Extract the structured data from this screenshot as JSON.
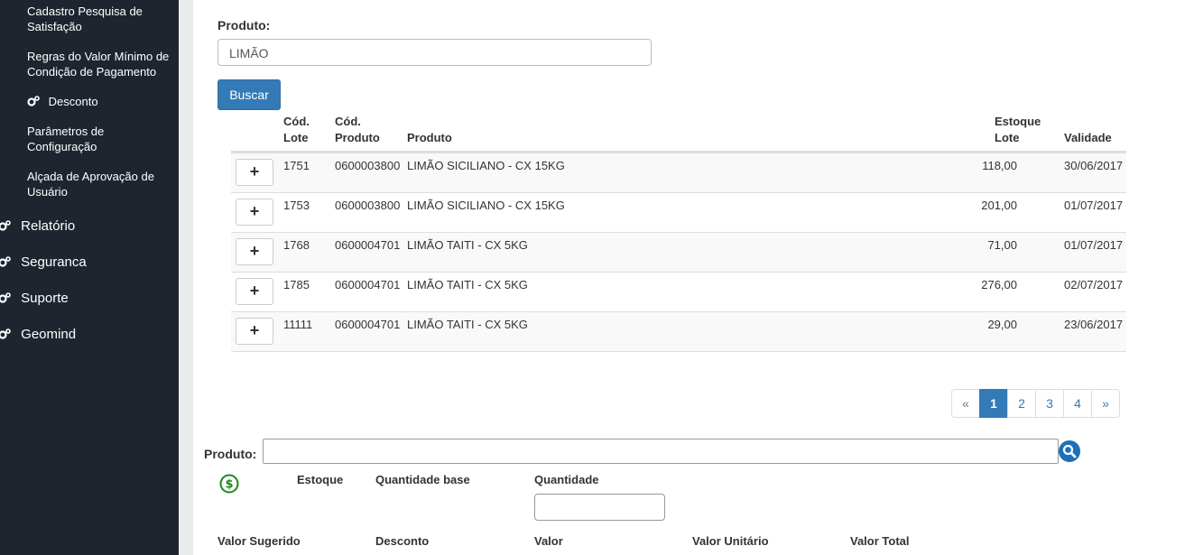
{
  "sidebar": {
    "sub_items": [
      {
        "label_line1": "Cadastro Pesquisa de",
        "label_line2": "Satisfação"
      },
      {
        "label_line1": "Regras do Valor Mínimo de",
        "label_line2": "Condição de Pagamento"
      },
      {
        "label": "Desconto",
        "icon": "gears-icon"
      },
      {
        "label_line1": "Parâmetros de",
        "label_line2": "Configuração"
      },
      {
        "label_line1": "Alçada de Aprovação de",
        "label_line2": "Usuário"
      }
    ],
    "main_items": [
      {
        "label": "Relatório",
        "icon": "gears-icon"
      },
      {
        "label": "Seguranca",
        "icon": "gears-icon"
      },
      {
        "label": "Suporte",
        "icon": "gears-icon"
      },
      {
        "label": "Geomind",
        "icon": "gears-icon"
      }
    ]
  },
  "search": {
    "label": "Produto:",
    "value": "LIMÃO",
    "button": "Buscar"
  },
  "table": {
    "headers": {
      "cod_lote_1": "Cód.",
      "cod_lote_2": "Lote",
      "cod_produto_1": "Cód.",
      "cod_produto_2": "Produto",
      "produto": "Produto",
      "estoque_1": "Estoque",
      "estoque_2": "Lote",
      "validade": "Validade"
    },
    "add_label": "+",
    "rows": [
      {
        "lote": "1751",
        "cod_produto": "0600003800",
        "produto": "LIMÃO SICILIANO - CX 15KG",
        "estoque": "118,00",
        "validade": "30/06/2017"
      },
      {
        "lote": "1753",
        "cod_produto": "0600003800",
        "produto": "LIMÃO SICILIANO - CX 15KG",
        "estoque": "201,00",
        "validade": "01/07/2017"
      },
      {
        "lote": "1768",
        "cod_produto": "0600004701",
        "produto": "LIMÃO TAITI - CX 5KG",
        "estoque": "71,00",
        "validade": "01/07/2017"
      },
      {
        "lote": "1785",
        "cod_produto": "0600004701",
        "produto": "LIMÃO TAITI - CX 5KG",
        "estoque": "276,00",
        "validade": "02/07/2017"
      },
      {
        "lote": "11111",
        "cod_produto": "0600004701",
        "produto": "LIMÃO TAITI - CX 5KG",
        "estoque": "29,00",
        "validade": "23/06/2017"
      }
    ]
  },
  "pagination": {
    "prev": "«",
    "pages": [
      "1",
      "2",
      "3",
      "4"
    ],
    "active": "1",
    "next": "»"
  },
  "form": {
    "produto_label": "Produto:",
    "produto_value": "",
    "estoque_label": "Estoque",
    "quantidade_base_label": "Quantidade base",
    "quantidade_label": "Quantidade",
    "quantidade_value": "",
    "valor_sugerido_label": "Valor Sugerido",
    "desconto_label": "Desconto",
    "valor_label": "Valor",
    "valor_unitario_label": "Valor Unitário",
    "valor_total_label": "Valor Total"
  },
  "colors": {
    "sidebar_bg": "#1f252e",
    "primary": "#337ab7",
    "money_icon": "#1a8a1a",
    "search_icon": "#1e6fb8"
  }
}
